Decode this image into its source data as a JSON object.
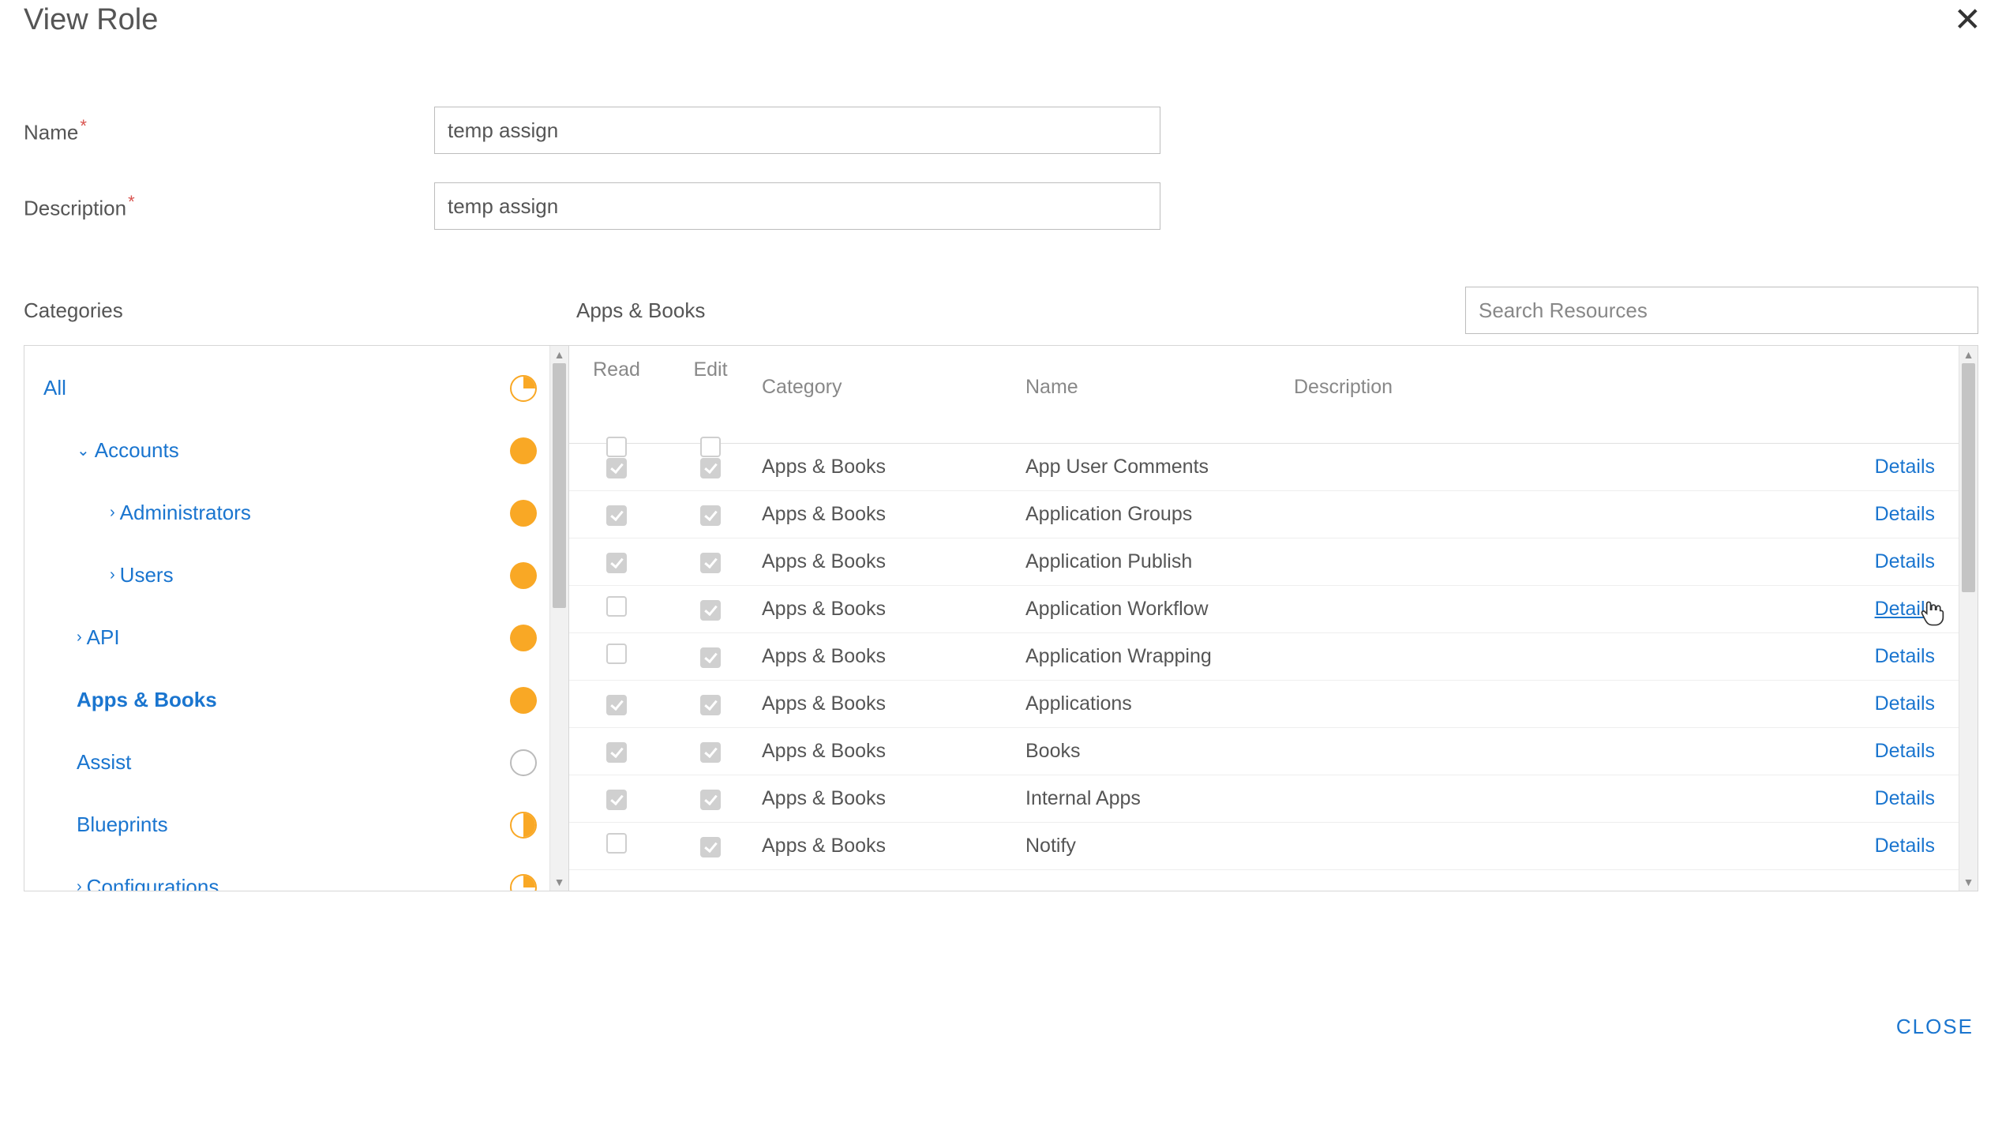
{
  "dialog": {
    "title": "View Role",
    "close_label": "CLOSE"
  },
  "form": {
    "name_label": "Name",
    "name_value": "temp assign",
    "description_label": "Description",
    "description_value": "temp assign"
  },
  "panels": {
    "categories_header": "Categories",
    "detail_header": "Apps & Books",
    "search_placeholder": "Search Resources"
  },
  "categories": [
    {
      "label": "All",
      "indent": 0,
      "chevron": "",
      "status": "partial",
      "selected": false
    },
    {
      "label": "Accounts",
      "indent": 1,
      "chevron": "down",
      "status": "full",
      "selected": false
    },
    {
      "label": "Administrators",
      "indent": 2,
      "chevron": "right",
      "status": "full",
      "selected": false
    },
    {
      "label": "Users",
      "indent": 2,
      "chevron": "right",
      "status": "full",
      "selected": false
    },
    {
      "label": "API",
      "indent": 1,
      "chevron": "right",
      "status": "full",
      "selected": false
    },
    {
      "label": "Apps & Books",
      "indent": 1,
      "chevron": "",
      "status": "full",
      "selected": true
    },
    {
      "label": "Assist",
      "indent": 1,
      "chevron": "",
      "status": "empty",
      "selected": false
    },
    {
      "label": "Blueprints",
      "indent": 1,
      "chevron": "",
      "status": "half",
      "selected": false
    },
    {
      "label": "Configurations",
      "indent": 1,
      "chevron": "right",
      "status": "partial",
      "selected": false
    }
  ],
  "table": {
    "columns": {
      "read": "Read",
      "edit": "Edit",
      "category": "Category",
      "name": "Name",
      "description": "Description",
      "details": "Details"
    },
    "rows": [
      {
        "read": true,
        "edit": true,
        "category": "Apps & Books",
        "name": "App User Comments",
        "description": "",
        "hovered": false
      },
      {
        "read": true,
        "edit": true,
        "category": "Apps & Books",
        "name": "Application Groups",
        "description": "",
        "hovered": false
      },
      {
        "read": true,
        "edit": true,
        "category": "Apps & Books",
        "name": "Application Publish",
        "description": "",
        "hovered": false
      },
      {
        "read": false,
        "edit": true,
        "category": "Apps & Books",
        "name": "Application Workflow",
        "description": "",
        "hovered": true
      },
      {
        "read": false,
        "edit": true,
        "category": "Apps & Books",
        "name": "Application Wrapping",
        "description": "",
        "hovered": false
      },
      {
        "read": true,
        "edit": true,
        "category": "Apps & Books",
        "name": "Applications",
        "description": "",
        "hovered": false
      },
      {
        "read": true,
        "edit": true,
        "category": "Apps & Books",
        "name": "Books",
        "description": "",
        "hovered": false
      },
      {
        "read": true,
        "edit": true,
        "category": "Apps & Books",
        "name": "Internal Apps",
        "description": "",
        "hovered": false
      },
      {
        "read": false,
        "edit": true,
        "category": "Apps & Books",
        "name": "Notify",
        "description": "",
        "hovered": false
      }
    ]
  },
  "cursor_position": {
    "row_index": 3
  }
}
